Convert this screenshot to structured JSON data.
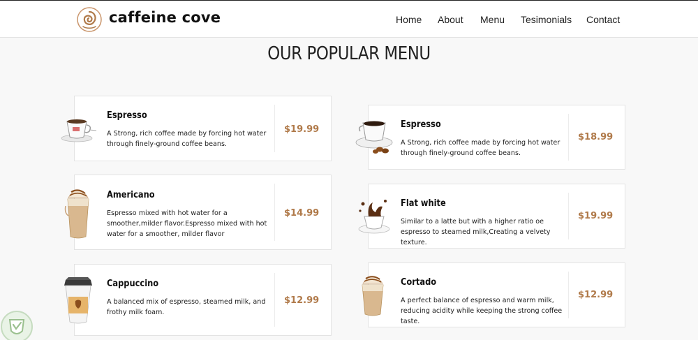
{
  "header": {
    "brand": "caffeine cove",
    "nav": [
      "Home",
      "About",
      "Menu",
      "Tesimonials",
      "Contact"
    ]
  },
  "section_title": "OUR POPULAR MENU",
  "menu": {
    "left": [
      {
        "name": "Espresso",
        "description": "A Strong, rich coffee made by forcing hot water through finely-ground coffee beans.",
        "price": "$19.99"
      },
      {
        "name": "Americano",
        "description": "Espresso mixed with hot water for a smoother,milder flavor.Espresso mixed with hot water for a smoother, milder flavor",
        "price": "$14.99"
      },
      {
        "name": "Cappuccino",
        "description": "A balanced mix of espresso, steamed milk, and frothy milk foam.",
        "price": "$12.99"
      }
    ],
    "right": [
      {
        "name": "Espresso",
        "description": "A Strong, rich coffee made by forcing hot water through finely-ground coffee beans.",
        "price": "$18.99"
      },
      {
        "name": "Flat white",
        "description": "Similar to a latte but with a higher ratio oe espresso to steamed milk,Creating a velvety texture.",
        "price": "$19.99"
      },
      {
        "name": "Cortado",
        "description": "A perfect balance of espresso and warm milk, reducing acidity while keeping the strong coffee taste.",
        "price": "$12.99"
      }
    ]
  },
  "colors": {
    "price": "#b07a4a",
    "accent_brown": "#8a5a36"
  }
}
